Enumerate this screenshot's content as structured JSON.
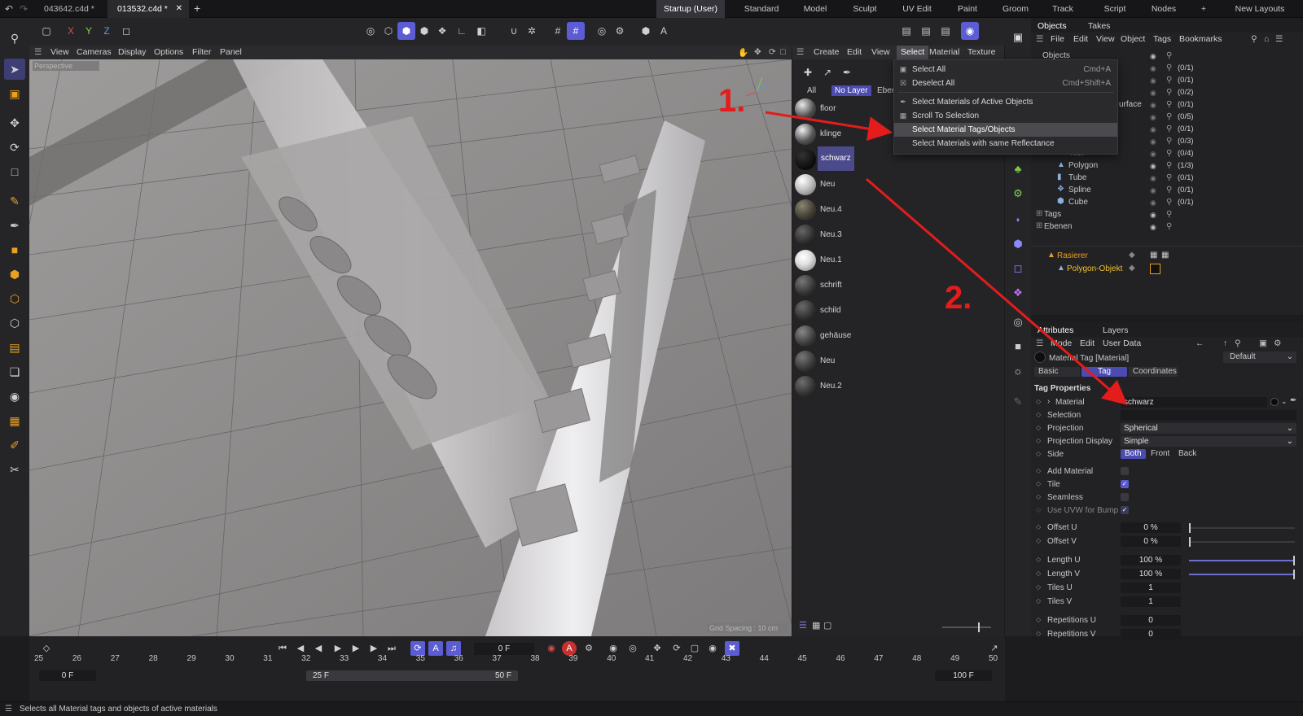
{
  "tabs": {
    "doc1": "043642.c4d *",
    "doc2": "013532.c4d *",
    "add": "+"
  },
  "layouts": {
    "items": [
      "Startup (User)",
      "Standard",
      "Model",
      "Sculpt",
      "UV Edit",
      "Paint",
      "Groom",
      "Track",
      "Script",
      "Nodes"
    ],
    "add": "+",
    "new_layouts": "New Layouts"
  },
  "axes": {
    "x": "X",
    "y": "Y",
    "z": "Z"
  },
  "viewport_menu": [
    "View",
    "Cameras",
    "Display",
    "Options",
    "Filter",
    "Panel"
  ],
  "viewport": {
    "camera_label": "Perspective",
    "grid_spacing": "Grid Spacing : 10 cm"
  },
  "material_menu": [
    "Create",
    "Edit",
    "View",
    "Select",
    "Material",
    "Texture"
  ],
  "material_filter": {
    "all": "All",
    "no_layer": "No Layer",
    "eben": "Eben"
  },
  "materials": [
    {
      "name": "floor"
    },
    {
      "name": "klinge"
    },
    {
      "name": "schwarz"
    },
    {
      "name": "Neu"
    },
    {
      "name": "Neu.4"
    },
    {
      "name": "Neu.3"
    },
    {
      "name": "Neu.1"
    },
    {
      "name": "schrift"
    },
    {
      "name": "schild"
    },
    {
      "name": "gehäuse"
    },
    {
      "name": "Neu"
    },
    {
      "name": "Neu.2"
    }
  ],
  "dropdown": {
    "items": [
      {
        "label": "Select All",
        "shortcut": "Cmd+A"
      },
      {
        "label": "Deselect All",
        "shortcut": "Cmd+Shift+A"
      },
      {
        "label": "Select Materials of Active Objects",
        "shortcut": ""
      },
      {
        "label": "Scroll To Selection",
        "shortcut": ""
      },
      {
        "label": "Select Material Tags/Objects",
        "shortcut": ""
      },
      {
        "label": "Select Materials with same Reflectance",
        "shortcut": ""
      }
    ]
  },
  "annotations": {
    "step1": "1.",
    "step2": "2."
  },
  "objects_panel": {
    "tabs": [
      "Objects",
      "Takes"
    ],
    "menu": [
      "File",
      "Edit",
      "View",
      "Object",
      "Tags",
      "Bookmarks"
    ],
    "rows": [
      {
        "name": "Objects",
        "count": ""
      },
      {
        "name": "",
        "count": "(0/1)"
      },
      {
        "name": "",
        "count": "(0/1)"
      },
      {
        "name": "",
        "count": "(0/2)"
      },
      {
        "name": "urface",
        "count": "(0/1)"
      },
      {
        "name": "",
        "count": "(0/5)"
      },
      {
        "name": "",
        "count": "(0/1)"
      },
      {
        "name": "",
        "count": "(0/3)"
      },
      {
        "name": "Null",
        "count": "(0/4)"
      },
      {
        "name": "Polygon",
        "count": "(1/3)"
      },
      {
        "name": "Tube",
        "count": "(0/1)"
      },
      {
        "name": "Spline",
        "count": "(0/1)"
      },
      {
        "name": "Cube",
        "count": "(0/1)"
      },
      {
        "name": "Tags",
        "count": ""
      },
      {
        "name": "Ebenen",
        "count": ""
      }
    ],
    "scene": [
      {
        "name": "Rasierer"
      },
      {
        "name": "Polygon-Objekt"
      }
    ]
  },
  "attributes": {
    "tabs": [
      "Attributes",
      "Layers"
    ],
    "menu": [
      "Mode",
      "Edit",
      "User Data"
    ],
    "title": "Material Tag [Material]",
    "preset": "Default",
    "subtabs": [
      "Basic",
      "Tag",
      "Coordinates"
    ],
    "section": "Tag Properties",
    "material_label": "Material",
    "material_value": "schwarz",
    "selection_label": "Selection",
    "projection_label": "Projection",
    "projection_value": "Spherical",
    "projection_display_label": "Projection Display",
    "projection_display_value": "Simple",
    "side_label": "Side",
    "side_options": [
      "Both",
      "Front",
      "Back"
    ],
    "add_material": "Add Material",
    "tile": "Tile",
    "seamless": "Seamless",
    "use_uvw": "Use UVW for Bump",
    "offset_u": {
      "label": "Offset U",
      "value": "0 %",
      "fraction": 0
    },
    "offset_v": {
      "label": "Offset V",
      "value": "0 %",
      "fraction": 0
    },
    "length_u": {
      "label": "Length U",
      "value": "100 %",
      "fraction": 1
    },
    "length_v": {
      "label": "Length V",
      "value": "100 %",
      "fraction": 1
    },
    "tiles_u": {
      "label": "Tiles U",
      "value": "1"
    },
    "tiles_v": {
      "label": "Tiles V",
      "value": "1"
    },
    "rep_u": {
      "label": "Repetitions U",
      "value": "0"
    },
    "rep_v": {
      "label": "Repetitions V",
      "value": "0"
    }
  },
  "timeline": {
    "frame_field": "0 F",
    "ticks": [
      "25",
      "26",
      "27",
      "28",
      "29",
      "30",
      "31",
      "32",
      "33",
      "34",
      "35",
      "36",
      "37",
      "38",
      "39",
      "40",
      "41",
      "42",
      "43",
      "44",
      "45",
      "46",
      "47",
      "48",
      "49",
      "50"
    ],
    "start": "0 F",
    "range_start": "25 F",
    "range_end": "50 F",
    "end": "100 F"
  },
  "status": "Selects all Material tags and objects of active materials"
}
